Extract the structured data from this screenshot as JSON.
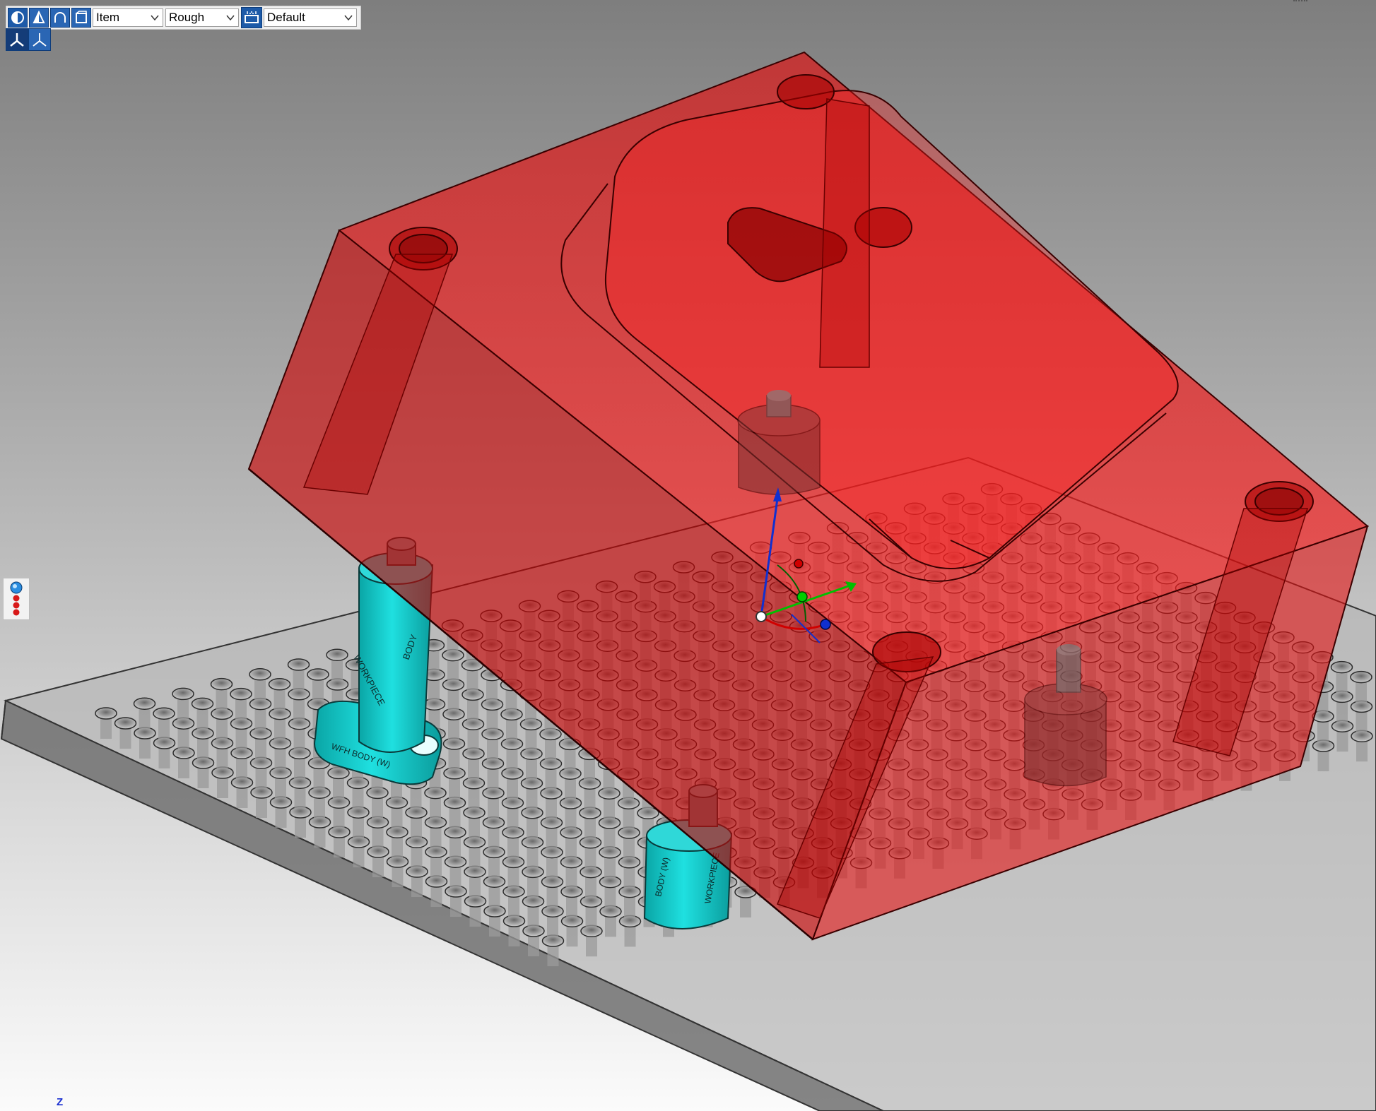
{
  "toolbar": {
    "buttons": [
      {
        "name": "shaded-sphere-icon"
      },
      {
        "name": "cone-icon"
      },
      {
        "name": "arch-icon"
      },
      {
        "name": "box-icon"
      }
    ],
    "item_combo": {
      "value": "Item",
      "options": [
        "Item"
      ]
    },
    "quality_combo": {
      "value": "Rough",
      "options": [
        "Rough"
      ]
    },
    "view_grid_icon": "grid-display-icon",
    "view_combo": {
      "value": "Default",
      "options": [
        "Default"
      ]
    }
  },
  "axes_toolbar": {
    "buttons": [
      {
        "name": "axis-triad-icon"
      },
      {
        "name": "axis-triad-alt-icon"
      }
    ]
  },
  "viewport": {
    "z_axis_label": "Z",
    "colors": {
      "workpiece": "#e00000",
      "fixture_cyan": "#14c4c4",
      "baseplate": "#8f8f8f",
      "pins": "#8a8a8a",
      "gizmo_x": "#00c000",
      "gizmo_y": "#1030d0",
      "gizmo_z": "#d00000"
    },
    "support_labels": {
      "post_left_a": "WORKPIECE",
      "post_left_b": "BODY",
      "base_flange": "WFH BODY (W)",
      "post_right_a": "BODY (W)",
      "post_right_b": "WORKPIECE"
    }
  },
  "side_widget": {
    "name": "dot-stack-icon"
  }
}
